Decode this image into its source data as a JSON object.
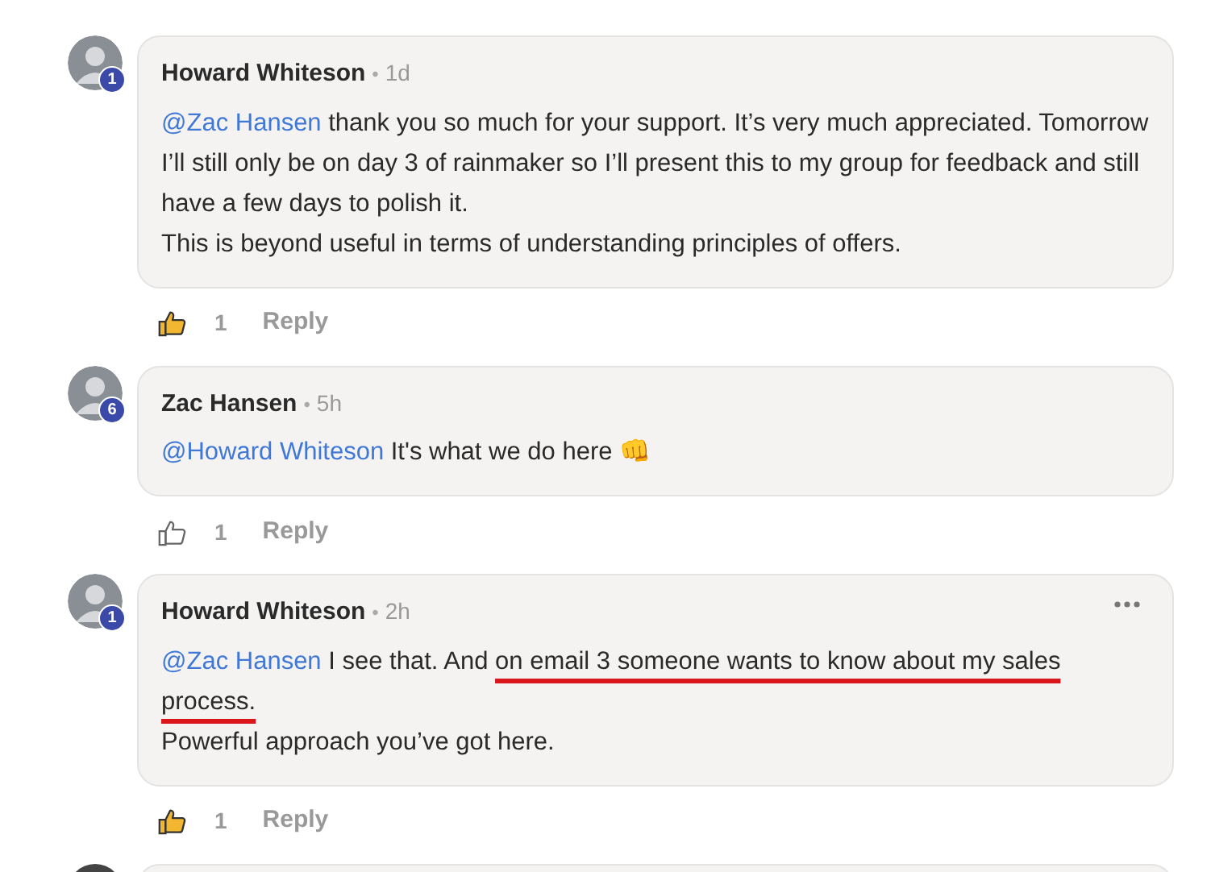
{
  "comments": [
    {
      "author": "Howard Whiteson",
      "separator": "•",
      "time": "1d",
      "badge": "1",
      "menu": false,
      "paragraphs": [
        [
          {
            "kind": "mention",
            "text": "@Zac Hansen"
          },
          {
            "kind": "text",
            "text": " thank you so much for your support. It’s very much appreciated. Tomorrow I’ll still only be on day 3 of rainmaker so I’ll present this to my group for feedback and still have a few days to polish it."
          }
        ],
        [
          {
            "kind": "text",
            "text": "This is beyond useful in terms of understanding principles of offers."
          }
        ]
      ],
      "liked": true,
      "likes": "1",
      "reply": "Reply"
    },
    {
      "author": "Zac Hansen",
      "separator": "•",
      "time": "5h",
      "badge": "6",
      "menu": false,
      "paragraphs": [
        [
          {
            "kind": "mention",
            "text": "@Howard Whiteson"
          },
          {
            "kind": "text",
            "text": " It's what we do here "
          },
          {
            "kind": "emoji",
            "text": "👊"
          }
        ]
      ],
      "liked": false,
      "likes": "1",
      "reply": "Reply"
    },
    {
      "author": "Howard Whiteson",
      "separator": "•",
      "time": "2h",
      "badge": "1",
      "menu": true,
      "paragraphs": [
        [
          {
            "kind": "mention",
            "text": "@Zac Hansen"
          },
          {
            "kind": "text",
            "text": " I see that. And "
          },
          {
            "kind": "underlined",
            "text": "on email 3 someone wants to know about my sales process."
          }
        ],
        [
          {
            "kind": "text",
            "text": "Powerful approach you’ve got here."
          }
        ]
      ],
      "liked": true,
      "likes": "1",
      "reply": "Reply"
    }
  ]
}
